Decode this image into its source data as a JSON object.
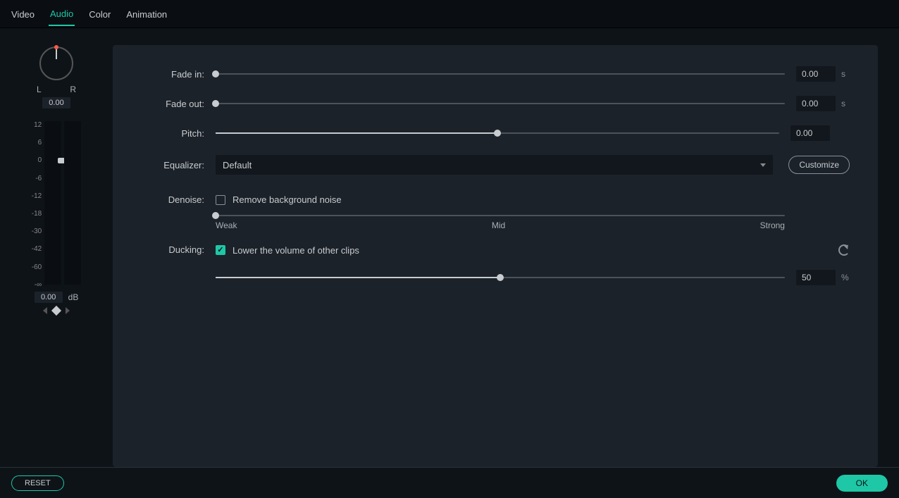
{
  "tabs": {
    "video": "Video",
    "audio": "Audio",
    "color": "Color",
    "animation": "Animation",
    "active": "audio"
  },
  "pan": {
    "l": "L",
    "r": "R",
    "value": "0.00"
  },
  "meter": {
    "ticks": [
      "12",
      "6",
      "0",
      "-6",
      "-12",
      "-18",
      "-30",
      "-42",
      "-60",
      "-∞"
    ],
    "value": "0.00",
    "unit": "dB"
  },
  "fade_in": {
    "label": "Fade in:",
    "value": "0.00",
    "unit": "s",
    "pos": 0
  },
  "fade_out": {
    "label": "Fade out:",
    "value": "0.00",
    "unit": "s",
    "pos": 0
  },
  "pitch": {
    "label": "Pitch:",
    "value": "0.00",
    "pos": 50
  },
  "equalizer": {
    "label": "Equalizer:",
    "selected": "Default",
    "customize": "Customize"
  },
  "denoise": {
    "label": "Denoise:",
    "checkbox_label": "Remove background noise",
    "checked": false,
    "pos": 0,
    "weak": "Weak",
    "mid": "Mid",
    "strong": "Strong"
  },
  "ducking": {
    "label": "Ducking:",
    "checkbox_label": "Lower the volume of other clips",
    "checked": true,
    "value": "50",
    "unit": "%",
    "pos": 50
  },
  "footer": {
    "reset": "RESET",
    "ok": "OK"
  }
}
